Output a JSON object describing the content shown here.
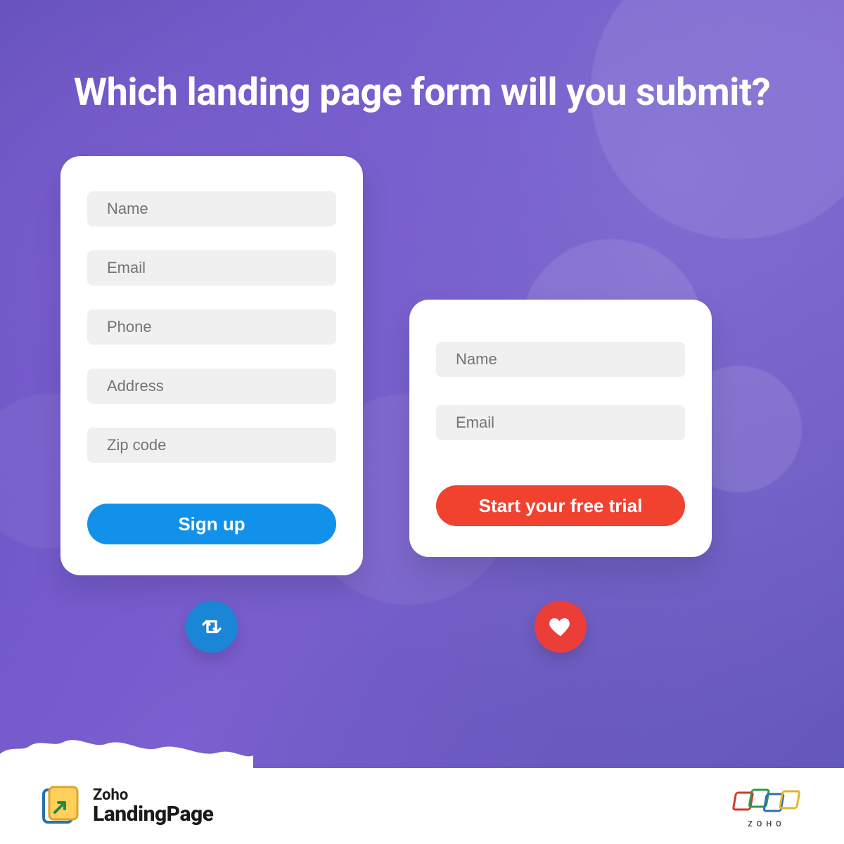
{
  "headline": "Which landing page form will you submit?",
  "form_a": {
    "fields": [
      {
        "placeholder": "Name"
      },
      {
        "placeholder": "Email"
      },
      {
        "placeholder": "Phone"
      },
      {
        "placeholder": "Address"
      },
      {
        "placeholder": "Zip code"
      }
    ],
    "cta_label": "Sign up",
    "cta_color": "#1291eb"
  },
  "form_b": {
    "fields": [
      {
        "placeholder": "Name"
      },
      {
        "placeholder": "Email"
      }
    ],
    "cta_label": "Start your free trial",
    "cta_color": "#f1412f"
  },
  "icons": {
    "retweet_color": "#1b86d6",
    "heart_color": "#ec3e39"
  },
  "footer": {
    "product_top": "Zoho",
    "product_bottom": "LandingPage",
    "brand_word": "ZOHO"
  }
}
